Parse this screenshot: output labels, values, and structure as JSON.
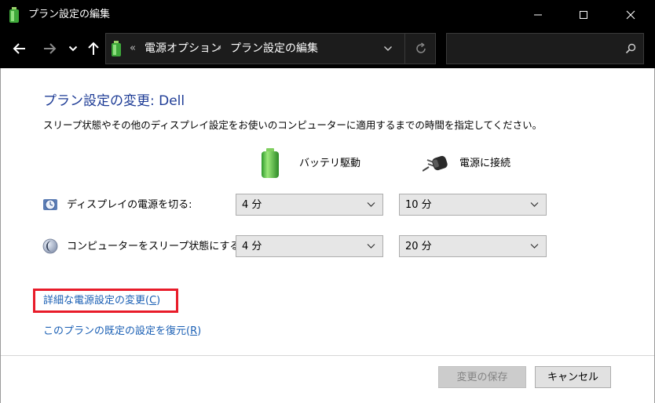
{
  "window": {
    "title": "プラン設定の編集",
    "icon": "power-options-battery-icon"
  },
  "nav": {
    "back_icon": "arrow-left-icon",
    "forward_icon": "arrow-right-icon",
    "recent_icon": "chevron-down-icon",
    "up_icon": "arrow-up-icon"
  },
  "address": {
    "overflow": "«",
    "crumbs": [
      "電源オプション",
      "プラン設定の編集"
    ],
    "separator": "›"
  },
  "search": {
    "placeholder": ""
  },
  "page": {
    "heading": "プラン設定の変更: Dell",
    "description": "スリープ状態やその他のディスプレイ設定をお使いのコンピューターに適用するまでの時間を指定してください。"
  },
  "columns": {
    "battery": "バッテリ駆動",
    "plugged": "電源に接続"
  },
  "settings": [
    {
      "label": "ディスプレイの電源を切る:",
      "icon": "display-power-icon",
      "battery": "4 分",
      "plugged": "10 分"
    },
    {
      "label": "コンピューターをスリープ状態にする:",
      "icon": "sleep-moon-icon",
      "battery": "4 分",
      "plugged": "20 分"
    }
  ],
  "links": {
    "advanced_pre": "詳細な電源設定の変更(",
    "advanced_key": "C",
    "advanced_post": ")",
    "restore_pre": "このプランの既定の設定を復元(",
    "restore_key": "R",
    "restore_post": ")"
  },
  "buttons": {
    "save": "変更の保存",
    "cancel": "キャンセル"
  },
  "colors": {
    "heading": "#1e3c96",
    "link": "#1a5fb4",
    "highlight": "#e81c2a"
  }
}
